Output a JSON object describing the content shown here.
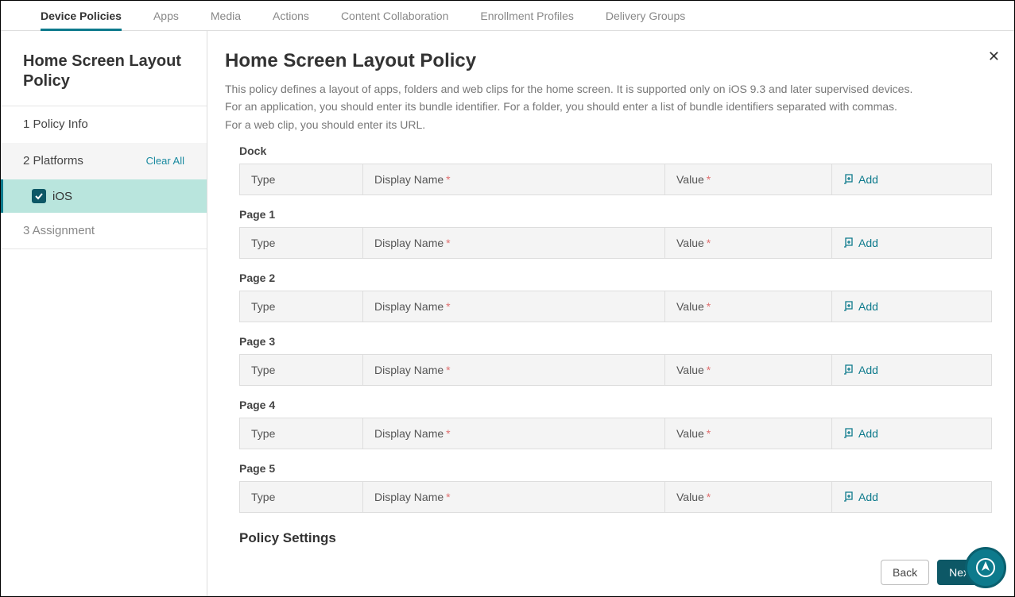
{
  "tabs": [
    "Device Policies",
    "Apps",
    "Media",
    "Actions",
    "Content Collaboration",
    "Enrollment Profiles",
    "Delivery Groups"
  ],
  "sidebar": {
    "title": "Home Screen Layout Policy",
    "step1": "1  Policy Info",
    "step2": "2  Platforms",
    "clearAll": "Clear All",
    "ios": "iOS",
    "step3": "3   Assignment"
  },
  "content": {
    "title": "Home Screen Layout Policy",
    "desc1": "This policy defines a layout of apps, folders and web clips for the home screen. It is supported only on iOS 9.3 and later supervised devices.",
    "desc2": "For an application, you should enter its bundle identifier. For a folder, you should enter a list of bundle identifiers separated with commas.",
    "desc3": "For a web clip, you should enter its URL.",
    "cols": {
      "type": "Type",
      "dname": "Display Name",
      "value": "Value",
      "add": "Add"
    },
    "sections": [
      "Dock",
      "Page 1",
      "Page 2",
      "Page 3",
      "Page 4",
      "Page 5"
    ],
    "policySettings": "Policy Settings"
  },
  "buttons": {
    "back": "Back",
    "next": "Next >"
  }
}
